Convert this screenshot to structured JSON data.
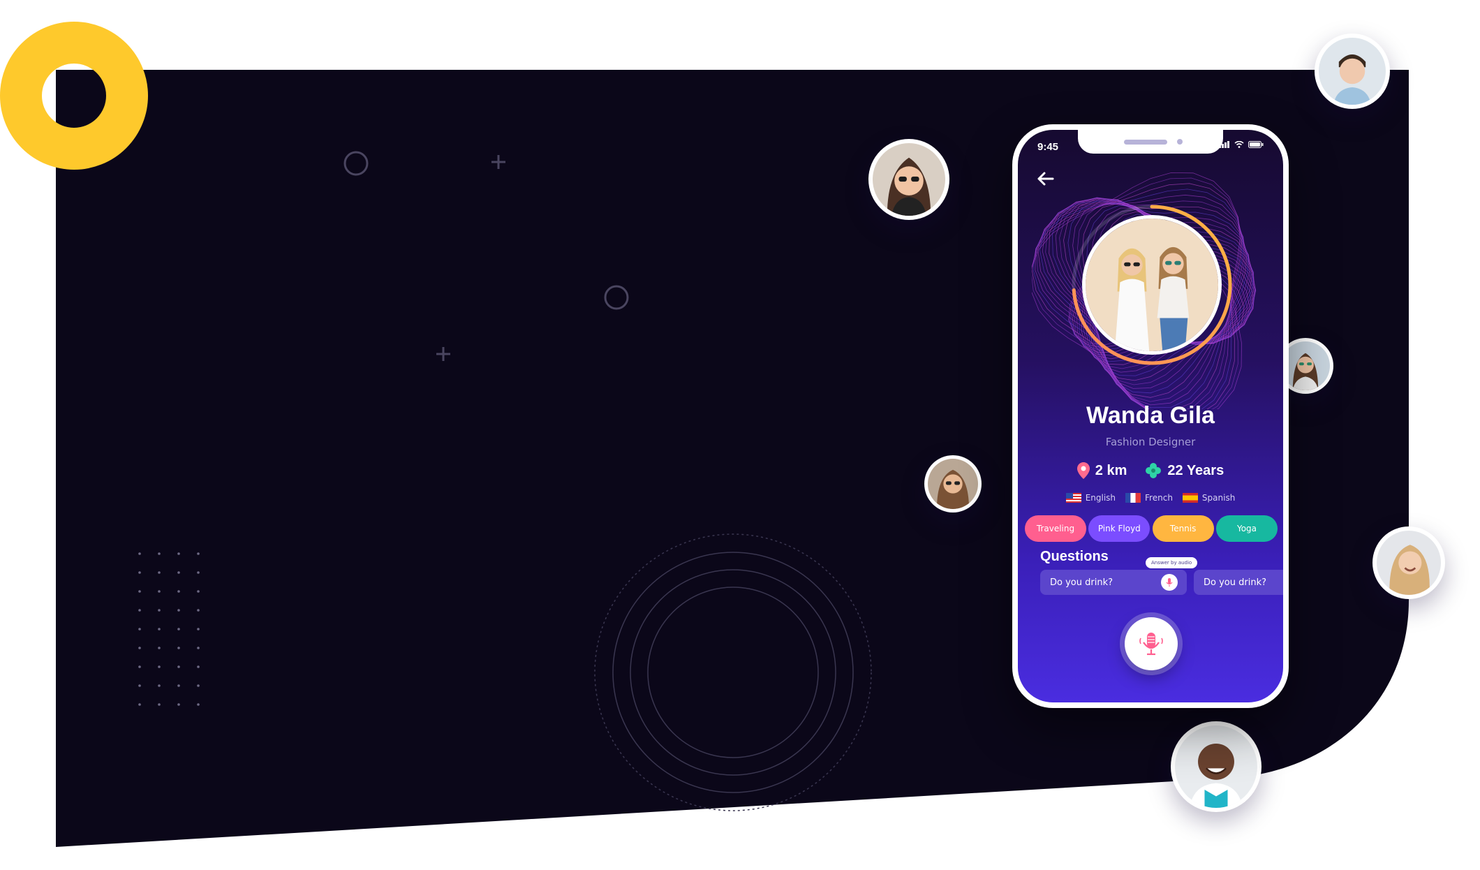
{
  "theme": {
    "background_dark": "#0b0719",
    "accent_yellow": "#fec92c",
    "phone_gradient_top": "#160a30",
    "phone_gradient_bottom": "#4a2de0"
  },
  "status_bar": {
    "time": "9:45"
  },
  "profile": {
    "name": "Wanda Gila",
    "job": "Fashion Designer",
    "distance": "2 km",
    "age": "22 Years",
    "languages": [
      {
        "label": "English",
        "flag": "us-flag-icon"
      },
      {
        "label": "French",
        "flag": "fr-flag-icon"
      },
      {
        "label": "Spanish",
        "flag": "es-flag-icon"
      }
    ],
    "interests": [
      {
        "label": "Traveling",
        "color": "#ff5f8f"
      },
      {
        "label": "Pink Floyd",
        "color": "#7b4dff"
      },
      {
        "label": "Tennis",
        "color": "#ffb640"
      },
      {
        "label": "Yoga",
        "color": "#17b8a0"
      }
    ]
  },
  "questions": {
    "title": "Questions",
    "tooltip": "Answer by audio",
    "items": [
      "Do you drink?",
      "Do you drink?"
    ]
  },
  "icons": {
    "back": "arrow-left-icon",
    "location": "location-pin-icon",
    "age": "clover-icon",
    "mic": "microphone-icon"
  }
}
